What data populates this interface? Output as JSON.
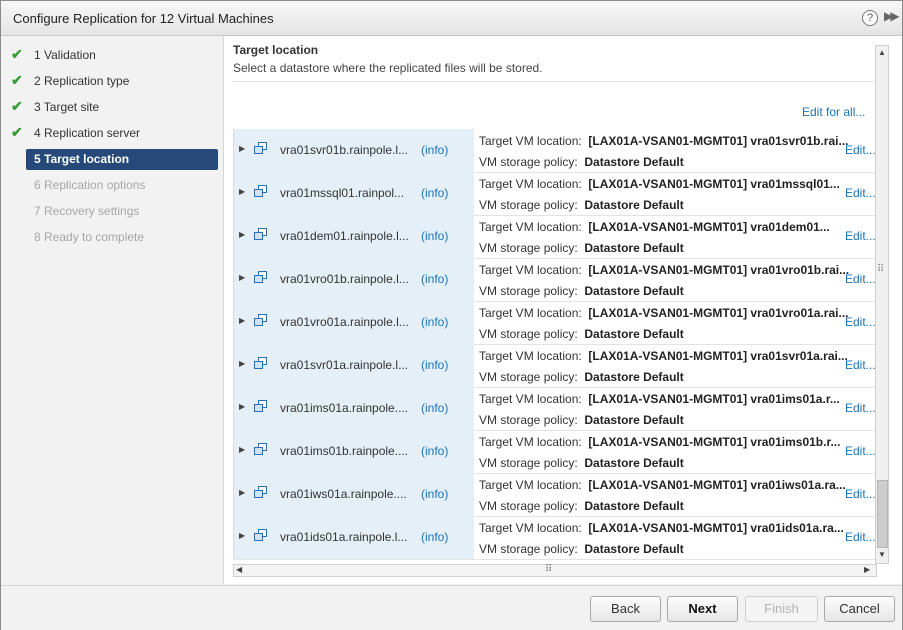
{
  "dialog": {
    "title": "Configure Replication for 12 Virtual Machines",
    "help_icon_glyph": "?",
    "popout_icon_glyph": "▶▶"
  },
  "steps": [
    {
      "label": "1  Validation",
      "state": "done",
      "check": "✔"
    },
    {
      "label": "2  Replication type",
      "state": "done",
      "check": "✔"
    },
    {
      "label": "3  Target site",
      "state": "done",
      "check": "✔"
    },
    {
      "label": "4  Replication server",
      "state": "done",
      "check": "✔"
    },
    {
      "label": "5  Target location",
      "state": "active"
    },
    {
      "label": "6  Replication options",
      "state": "pending"
    },
    {
      "label": "7  Recovery settings",
      "state": "pending"
    },
    {
      "label": "8  Ready to complete",
      "state": "pending"
    }
  ],
  "main": {
    "title": "Target location",
    "subtitle": "Select a datastore where the replicated files will be stored.",
    "edit_all": "Edit for all..."
  },
  "table": {
    "info_label": "(info)",
    "location_label": "Target VM location:",
    "policy_label": "VM storage policy:",
    "policy_value": "Datastore Default",
    "edit_label": "Edit...",
    "expand_glyph": "▶",
    "rows": [
      {
        "vm": "vra01svr01b.rainpole.l...",
        "location": "[LAX01A-VSAN01-MGMT01] vra01svr01b.rai..."
      },
      {
        "vm": "vra01mssql01.rainpol...",
        "location": "[LAX01A-VSAN01-MGMT01] vra01mssql01..."
      },
      {
        "vm": "vra01dem01.rainpole.l...",
        "location": "[LAX01A-VSAN01-MGMT01] vra01dem01..."
      },
      {
        "vm": "vra01vro01b.rainpole.l...",
        "location": "[LAX01A-VSAN01-MGMT01] vra01vro01b.rai..."
      },
      {
        "vm": "vra01vro01a.rainpole.l...",
        "location": "[LAX01A-VSAN01-MGMT01] vra01vro01a.rai..."
      },
      {
        "vm": "vra01svr01a.rainpole.l...",
        "location": "[LAX01A-VSAN01-MGMT01] vra01svr01a.rai..."
      },
      {
        "vm": "vra01ims01a.rainpole....",
        "location": "[LAX01A-VSAN01-MGMT01] vra01ims01a.r..."
      },
      {
        "vm": "vra01ims01b.rainpole....",
        "location": "[LAX01A-VSAN01-MGMT01] vra01ims01b.r..."
      },
      {
        "vm": "vra01iws01a.rainpole....",
        "location": "[LAX01A-VSAN01-MGMT01] vra01iws01a.ra..."
      },
      {
        "vm": "vra01ids01a.rainpole.l...",
        "location": "[LAX01A-VSAN01-MGMT01] vra01ids01a.ra..."
      }
    ]
  },
  "scrollbars": {
    "up": "▲",
    "down": "▼",
    "left": "◀",
    "right": "▶",
    "grip": "⠿"
  },
  "footer": {
    "back": "Back",
    "next": "Next",
    "finish": "Finish",
    "cancel": "Cancel"
  },
  "colors": {
    "active_step_bg": "#26497a",
    "link": "#1a73b8",
    "check": "#3a9b3a",
    "vm_cell_bg": "#e4eff8"
  }
}
